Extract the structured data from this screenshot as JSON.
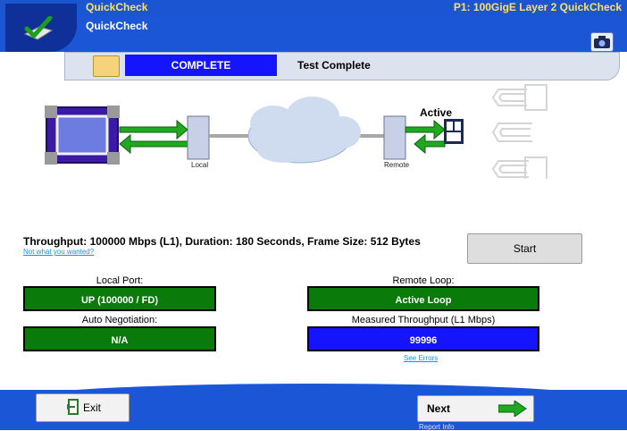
{
  "header": {
    "app_title": "QuickCheck",
    "sub_title": "QuickCheck",
    "mode_title": "P1: 100GigE Layer 2 QuickCheck",
    "camera_icon": "camera-icon",
    "logo_icon": "checkmark-icon"
  },
  "status": {
    "badge": "COMPLETE",
    "text": "Test Complete",
    "note_icon": "note-icon"
  },
  "diagram": {
    "local_label": "Local",
    "remote_label": "Remote",
    "active_label": "Active",
    "loop_icons": [
      "loop-ids-icon",
      "loop-arrow-icon",
      "loop-bracket-icon"
    ]
  },
  "test": {
    "summary": "Throughput: 100000 Mbps (L1), Duration: 180 Seconds, Frame Size: 512 Bytes",
    "link": "Not what you wanted?",
    "start_label": "Start"
  },
  "results": {
    "local_port": {
      "label": "Local Port:",
      "value": "UP (100000 / FD)"
    },
    "auto_negotiation": {
      "label": "Auto Negotiation:",
      "value": "N/A"
    },
    "remote_loop": {
      "label": "Remote Loop:",
      "value": "Active Loop"
    },
    "measured_throughput": {
      "label": "Measured Throughput (L1 Mbps)",
      "value": "99996"
    },
    "see_errors": "See Errors"
  },
  "footer": {
    "exit_label": "Exit",
    "next_label": "Next",
    "report_info": "Report Info"
  },
  "colors": {
    "header_blue": "#1a56d6",
    "status_blue": "#1414ff",
    "ok_green": "#0a7a0a",
    "title_yellow": "#ffe066",
    "link_blue": "#1a8fff"
  }
}
